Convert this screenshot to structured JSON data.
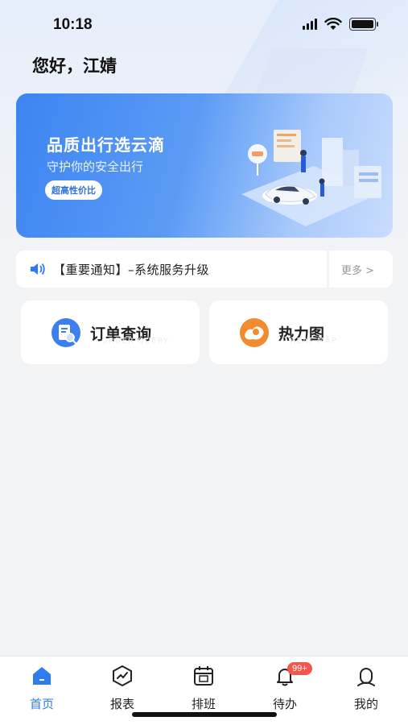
{
  "status_bar": {
    "time": "10:18"
  },
  "greeting": "您好，江婧",
  "banner": {
    "title": "品质出行选云滴",
    "subtitle": "守护你的安全出行",
    "tag": "超高性价比"
  },
  "notice": {
    "text": "【重要通知】–系统服务升级",
    "more": "更多 >"
  },
  "cards": [
    {
      "label": "订单查询",
      "watermark": "ORDER QUERY",
      "icon": "order-search-icon",
      "color": "#3b7ff0"
    },
    {
      "label": "热力图",
      "watermark": "HEAT MAP",
      "icon": "heatmap-icon",
      "color": "#f28a2e"
    }
  ],
  "tabbar": {
    "items": [
      {
        "label": "首页",
        "icon": "home-icon",
        "active": true
      },
      {
        "label": "报表",
        "icon": "report-icon",
        "active": false
      },
      {
        "label": "排班",
        "icon": "calendar-icon",
        "active": false
      },
      {
        "label": "待办",
        "icon": "bell-icon",
        "active": false,
        "badge": "99+"
      },
      {
        "label": "我的",
        "icon": "user-icon",
        "active": false
      }
    ]
  },
  "colors": {
    "accent": "#2f7bf0",
    "badge": "#f5554a",
    "background": "#f2f3f5"
  }
}
